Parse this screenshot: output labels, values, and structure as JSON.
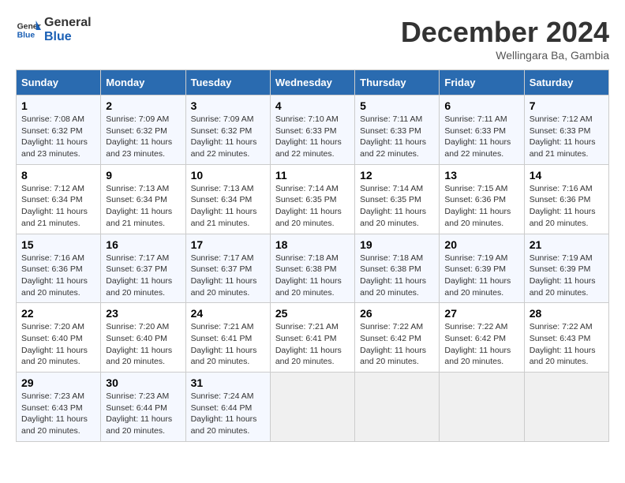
{
  "logo": {
    "text_general": "General",
    "text_blue": "Blue"
  },
  "title": "December 2024",
  "location": "Wellingara Ba, Gambia",
  "days_of_week": [
    "Sunday",
    "Monday",
    "Tuesday",
    "Wednesday",
    "Thursday",
    "Friday",
    "Saturday"
  ],
  "weeks": [
    [
      {
        "day": "1",
        "sunrise": "7:08 AM",
        "sunset": "6:32 PM",
        "daylight": "11 hours and 23 minutes."
      },
      {
        "day": "2",
        "sunrise": "7:09 AM",
        "sunset": "6:32 PM",
        "daylight": "11 hours and 23 minutes."
      },
      {
        "day": "3",
        "sunrise": "7:09 AM",
        "sunset": "6:32 PM",
        "daylight": "11 hours and 22 minutes."
      },
      {
        "day": "4",
        "sunrise": "7:10 AM",
        "sunset": "6:33 PM",
        "daylight": "11 hours and 22 minutes."
      },
      {
        "day": "5",
        "sunrise": "7:11 AM",
        "sunset": "6:33 PM",
        "daylight": "11 hours and 22 minutes."
      },
      {
        "day": "6",
        "sunrise": "7:11 AM",
        "sunset": "6:33 PM",
        "daylight": "11 hours and 22 minutes."
      },
      {
        "day": "7",
        "sunrise": "7:12 AM",
        "sunset": "6:33 PM",
        "daylight": "11 hours and 21 minutes."
      }
    ],
    [
      {
        "day": "8",
        "sunrise": "7:12 AM",
        "sunset": "6:34 PM",
        "daylight": "11 hours and 21 minutes."
      },
      {
        "day": "9",
        "sunrise": "7:13 AM",
        "sunset": "6:34 PM",
        "daylight": "11 hours and 21 minutes."
      },
      {
        "day": "10",
        "sunrise": "7:13 AM",
        "sunset": "6:34 PM",
        "daylight": "11 hours and 21 minutes."
      },
      {
        "day": "11",
        "sunrise": "7:14 AM",
        "sunset": "6:35 PM",
        "daylight": "11 hours and 20 minutes."
      },
      {
        "day": "12",
        "sunrise": "7:14 AM",
        "sunset": "6:35 PM",
        "daylight": "11 hours and 20 minutes."
      },
      {
        "day": "13",
        "sunrise": "7:15 AM",
        "sunset": "6:36 PM",
        "daylight": "11 hours and 20 minutes."
      },
      {
        "day": "14",
        "sunrise": "7:16 AM",
        "sunset": "6:36 PM",
        "daylight": "11 hours and 20 minutes."
      }
    ],
    [
      {
        "day": "15",
        "sunrise": "7:16 AM",
        "sunset": "6:36 PM",
        "daylight": "11 hours and 20 minutes."
      },
      {
        "day": "16",
        "sunrise": "7:17 AM",
        "sunset": "6:37 PM",
        "daylight": "11 hours and 20 minutes."
      },
      {
        "day": "17",
        "sunrise": "7:17 AM",
        "sunset": "6:37 PM",
        "daylight": "11 hours and 20 minutes."
      },
      {
        "day": "18",
        "sunrise": "7:18 AM",
        "sunset": "6:38 PM",
        "daylight": "11 hours and 20 minutes."
      },
      {
        "day": "19",
        "sunrise": "7:18 AM",
        "sunset": "6:38 PM",
        "daylight": "11 hours and 20 minutes."
      },
      {
        "day": "20",
        "sunrise": "7:19 AM",
        "sunset": "6:39 PM",
        "daylight": "11 hours and 20 minutes."
      },
      {
        "day": "21",
        "sunrise": "7:19 AM",
        "sunset": "6:39 PM",
        "daylight": "11 hours and 20 minutes."
      }
    ],
    [
      {
        "day": "22",
        "sunrise": "7:20 AM",
        "sunset": "6:40 PM",
        "daylight": "11 hours and 20 minutes."
      },
      {
        "day": "23",
        "sunrise": "7:20 AM",
        "sunset": "6:40 PM",
        "daylight": "11 hours and 20 minutes."
      },
      {
        "day": "24",
        "sunrise": "7:21 AM",
        "sunset": "6:41 PM",
        "daylight": "11 hours and 20 minutes."
      },
      {
        "day": "25",
        "sunrise": "7:21 AM",
        "sunset": "6:41 PM",
        "daylight": "11 hours and 20 minutes."
      },
      {
        "day": "26",
        "sunrise": "7:22 AM",
        "sunset": "6:42 PM",
        "daylight": "11 hours and 20 minutes."
      },
      {
        "day": "27",
        "sunrise": "7:22 AM",
        "sunset": "6:42 PM",
        "daylight": "11 hours and 20 minutes."
      },
      {
        "day": "28",
        "sunrise": "7:22 AM",
        "sunset": "6:43 PM",
        "daylight": "11 hours and 20 minutes."
      }
    ],
    [
      {
        "day": "29",
        "sunrise": "7:23 AM",
        "sunset": "6:43 PM",
        "daylight": "11 hours and 20 minutes."
      },
      {
        "day": "30",
        "sunrise": "7:23 AM",
        "sunset": "6:44 PM",
        "daylight": "11 hours and 20 minutes."
      },
      {
        "day": "31",
        "sunrise": "7:24 AM",
        "sunset": "6:44 PM",
        "daylight": "11 hours and 20 minutes."
      },
      null,
      null,
      null,
      null
    ]
  ],
  "labels": {
    "sunrise": "Sunrise:",
    "sunset": "Sunset:",
    "daylight": "Daylight:"
  }
}
